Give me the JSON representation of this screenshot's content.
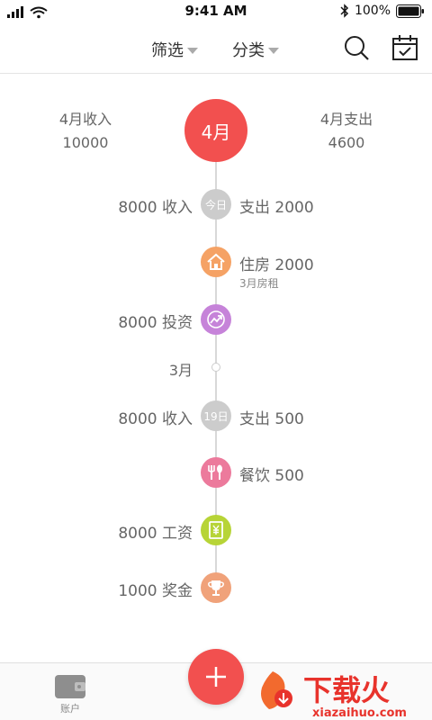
{
  "status_bar": {
    "time": "9:41 AM",
    "battery": "100%"
  },
  "nav": {
    "filter_label": "筛选",
    "category_label": "分类",
    "search_icon": "search-icon",
    "calendar_icon": "calendar-check-icon"
  },
  "summary": {
    "income_label": "4月收入",
    "income_value": "10000",
    "month": "4月",
    "expense_label": "4月支出",
    "expense_value": "4600"
  },
  "timeline": {
    "today_badge": "今日",
    "today_income": "8000  收入",
    "today_expense": "支出  2000",
    "housing": {
      "label": "住房  2000",
      "note": "3月房租",
      "icon": "house-icon",
      "color": "#f5a265"
    },
    "invest": {
      "label": "8000  投资",
      "icon": "trend-up-icon",
      "color": "#c683d9"
    },
    "month_marker": "3月",
    "day_badge": "19日",
    "day_income": "8000  收入",
    "day_expense": "支出  500",
    "dining": {
      "label": "餐饮  500",
      "icon": "fork-spoon-icon",
      "color": "#ec7a9c"
    },
    "salary": {
      "label": "8000  工资",
      "icon": "yen-bill-icon",
      "color": "#b7d437"
    },
    "bonus": {
      "label": "1000  奖金",
      "icon": "trophy-icon",
      "color": "#f0a27a"
    }
  },
  "bottom": {
    "account_tab": "账户",
    "add_icon": "plus-icon"
  },
  "watermark": {
    "text": "下载火",
    "url": "xiazaihuo.com"
  },
  "colors": {
    "accent": "#f2504f"
  }
}
